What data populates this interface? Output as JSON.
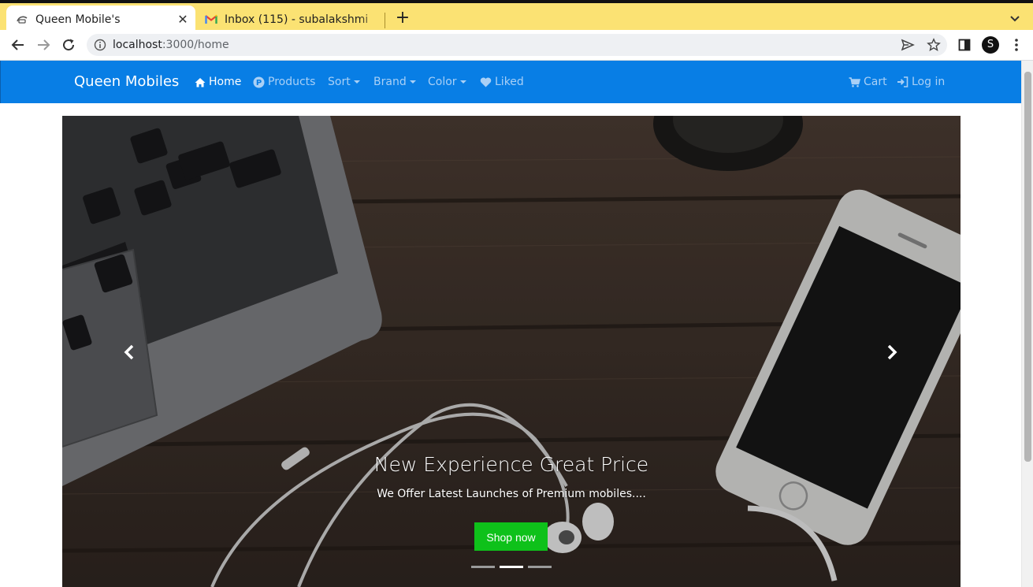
{
  "browser": {
    "tabs": [
      {
        "title": "Queen Mobile's",
        "active": true,
        "favicon": "phone-favicon"
      },
      {
        "title": "Inbox (115) - subalakshmi",
        "active": false,
        "favicon": "gmail-icon"
      }
    ],
    "url_host": "localhost",
    "url_path": ":3000/home",
    "profile_initial": "S"
  },
  "navbar": {
    "brand": "Queen Mobiles",
    "items": [
      {
        "label": "Home",
        "icon": "home-icon",
        "active": true
      },
      {
        "label": "Products",
        "icon": "p-circle-icon"
      },
      {
        "label": "Sort",
        "dropdown": true
      },
      {
        "label": "Brand",
        "dropdown": true
      },
      {
        "label": "Color",
        "dropdown": true
      },
      {
        "label": "Liked",
        "icon": "heart-icon"
      }
    ],
    "right": [
      {
        "label": "Cart",
        "icon": "cart-icon"
      },
      {
        "label": "Log in",
        "icon": "login-icon"
      }
    ],
    "bg_color": "#087ee5"
  },
  "carousel": {
    "title": "New Experience Great Price",
    "subtitle": "We Offer Latest Launches of Premium mobiles....",
    "button_label": "Shop now",
    "button_color": "#0ec11a",
    "slide_count": 3,
    "active_slide": 2
  }
}
